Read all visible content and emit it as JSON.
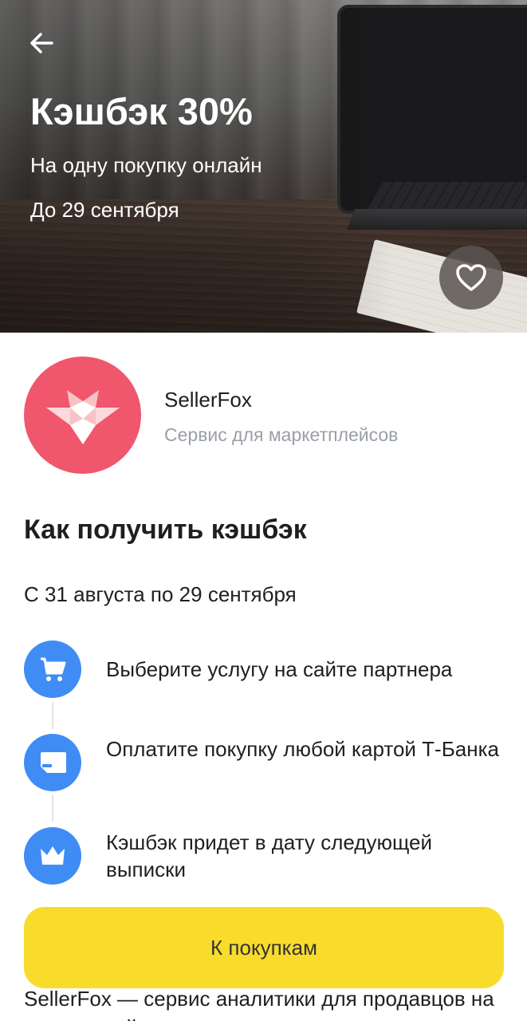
{
  "hero": {
    "title": "Кэшбэк 30%",
    "subtitle": "На одну покупку онлайн",
    "deadline": "До 29 сентября",
    "back_icon": "arrow-left-icon",
    "favorite_icon": "heart-outline-icon"
  },
  "partner": {
    "name": "SellerFox",
    "description": "Сервис для маркетплейсов",
    "logo_icon": "fox-logo-icon",
    "logo_color": "#f0566c"
  },
  "how_to": {
    "title": "Как получить кэшбэк",
    "period": "С 31 августа по 29 сентября",
    "steps": [
      {
        "icon": "cart-icon",
        "text": "Выберите услугу на сайте партнера"
      },
      {
        "icon": "card-icon",
        "text": "Оплатите покупку любой картой Т-Банка"
      },
      {
        "icon": "crown-icon",
        "text": "Кэшбэк придет в дату следующей выписки"
      }
    ]
  },
  "cta": {
    "label": "К покупкам",
    "color": "#f9dc2b"
  },
  "about": {
    "text": "SellerFox — сервис аналитики для продавцов на маркетплейсах: данные по"
  },
  "colors": {
    "accent_blue": "#3f8cf5",
    "secondary_text": "#9a9fa6"
  }
}
